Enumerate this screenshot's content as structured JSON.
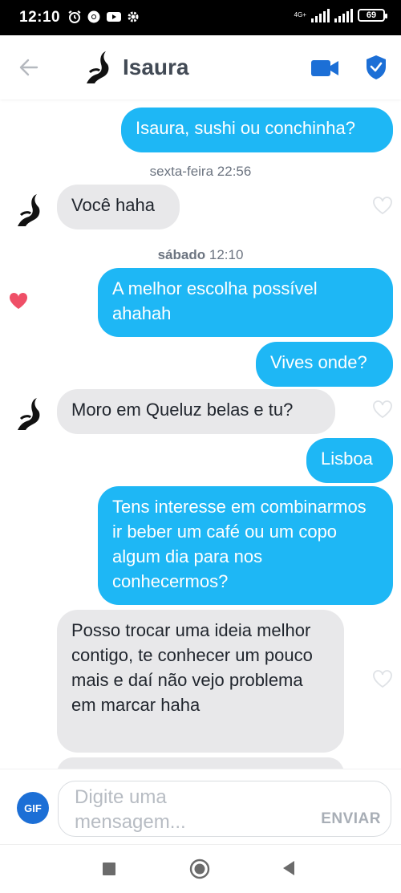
{
  "status_bar": {
    "time": "12:10",
    "network_label": "4G+",
    "battery": "69"
  },
  "header": {
    "contact_name": "Isaura",
    "icons": [
      "back-arrow-icon",
      "video-call-icon",
      "safety-shield-icon"
    ]
  },
  "colors": {
    "outgoing_bubble": "#1eb7f5",
    "incoming_bubble": "#e8e8ea",
    "accent_blue": "#1c6fd6",
    "like_red": "#ef4f67"
  },
  "conversation": {
    "msg1": "Isaura, sushi ou conchinha?",
    "stamp1_day": "sexta-feira",
    "stamp1_time": "22:56",
    "msg2": "Você haha",
    "stamp2_day": "sábado",
    "stamp2_time": "12:10",
    "msg3": "A melhor escolha possível ahahah",
    "msg4": "Vives onde?",
    "msg5": "Moro em Queluz belas e tu?",
    "msg6": "Lisboa",
    "msg7": "Tens interesse em combinarmos ir beber um café ou um copo algum dia para nos conhecermos?",
    "msg8": "Posso trocar uma ideia melhor contigo, te conhecer um pouco mais e daí não vejo problema em marcar haha"
  },
  "composer": {
    "gif_label": "GIF",
    "placeholder": "Digite uma mensagem...",
    "send_label": "ENVIAR"
  }
}
